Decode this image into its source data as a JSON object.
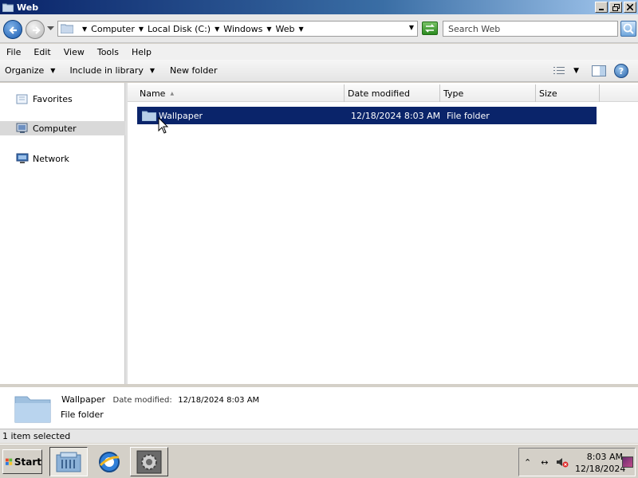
{
  "window": {
    "title": "Web"
  },
  "address": {
    "crumbs": [
      "Computer",
      "Local Disk (C:)",
      "Windows",
      "Web"
    ],
    "search_placeholder": "Search Web"
  },
  "menu": [
    "File",
    "Edit",
    "View",
    "Tools",
    "Help"
  ],
  "commands": {
    "organize": "Organize",
    "include": "Include in library",
    "new_folder": "New folder"
  },
  "nav": {
    "favorites": "Favorites",
    "computer": "Computer",
    "network": "Network"
  },
  "columns": [
    "Name",
    "Date modified",
    "Type",
    "Size"
  ],
  "files": [
    {
      "name": "Wallpaper",
      "date": "12/18/2024 8:03 AM",
      "type": "File folder",
      "size": ""
    }
  ],
  "details": {
    "name": "Wallpaper",
    "date_label": "Date modified:",
    "date": "12/18/2024 8:03 AM",
    "type": "File folder"
  },
  "status": "1 item selected",
  "taskbar": {
    "start": "Start",
    "time": "8:03 AM",
    "date": "12/18/2024"
  },
  "colors": {
    "selection": "#0a246a",
    "titlebar": "#0a246a",
    "face": "#d4d0c8"
  }
}
